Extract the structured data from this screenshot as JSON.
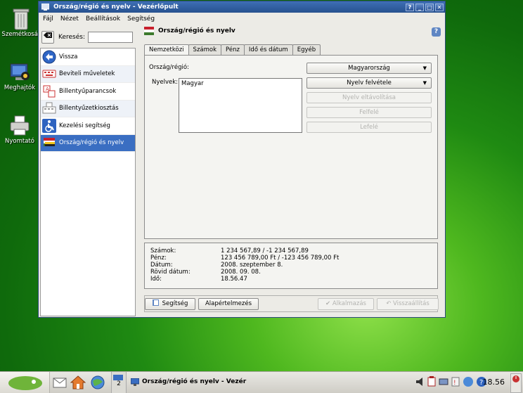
{
  "desktop": {
    "icons": [
      {
        "label": "Szemétkosár"
      },
      {
        "label": "Meghajtók"
      },
      {
        "label": "Nyomtató"
      }
    ]
  },
  "window": {
    "title": "Ország/régió és nyelv - Vezérlőpult",
    "buttons": [
      "?",
      "_",
      "□",
      "✕"
    ]
  },
  "menubar": [
    "Fájl",
    "Nézet",
    "Beállítások",
    "Segítség"
  ],
  "search": {
    "label": "Keresés:",
    "value": ""
  },
  "sidebar": {
    "items": [
      {
        "label": "Vissza",
        "icon": "back-arrow-icon"
      },
      {
        "label": "Beviteli műveletek",
        "icon": "keyboard-icon"
      },
      {
        "label": "Billentyűparancsok",
        "icon": "shortcuts-icon"
      },
      {
        "label": "Billentyűzetkiosztás",
        "icon": "keyboard-layout-icon"
      },
      {
        "label": "Kezelési segítség",
        "icon": "accessibility-icon"
      },
      {
        "label": "Ország/régió és nyelv",
        "icon": "flag-icon"
      }
    ]
  },
  "page": {
    "title": "Ország/régió és nyelv",
    "tabs": [
      "Nemzetközi",
      "Számok",
      "Pénz",
      "Idő és dátum",
      "Egyéb"
    ],
    "country_label": "Ország/régió:",
    "country_value": "Magyarország",
    "languages_label": "Nyelvek:",
    "languages": [
      "Magyar"
    ],
    "add_language": "Nyelv felvétele",
    "remove_language": "Nyelv eltávolítása",
    "move_up": "Felfelé",
    "move_down": "Lefelé"
  },
  "summary": [
    {
      "label": "Számok:",
      "value": "1 234 567,89 / -1 234 567,89"
    },
    {
      "label": "Pénz:",
      "value": "123 456 789,00 Ft / -123 456 789,00 Ft"
    },
    {
      "label": "Dátum:",
      "value": "2008. szeptember 8."
    },
    {
      "label": "Rövid dátum:",
      "value": "2008. 09. 08."
    },
    {
      "label": "Idő:",
      "value": "18.56.47"
    }
  ],
  "footer": {
    "help": "Segítség",
    "defaults": "Alapértelmezés",
    "apply": "Alkalmazás",
    "reset": "Visszaállítás"
  },
  "taskbar": {
    "desktop_number": "2",
    "app": "Ország/régió és nyelv - Vezér",
    "clock": "18.56"
  }
}
